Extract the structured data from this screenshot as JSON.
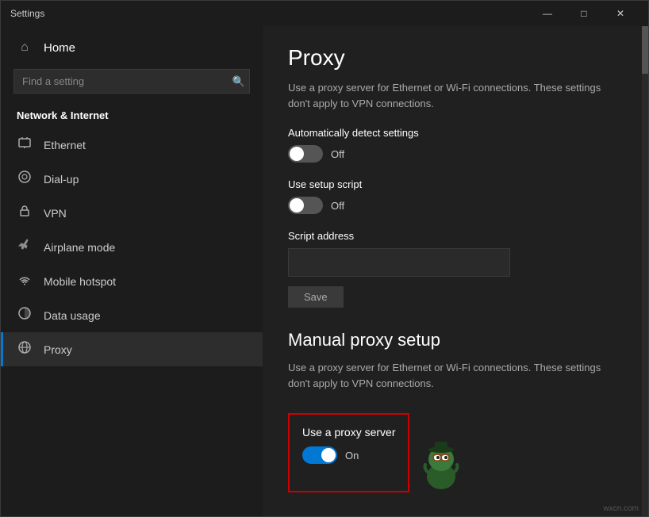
{
  "window": {
    "title": "Settings",
    "controls": {
      "minimize": "—",
      "maximize": "□",
      "close": "✕"
    }
  },
  "sidebar": {
    "home_label": "Home",
    "search_placeholder": "Find a setting",
    "section_title": "Network & Internet",
    "items": [
      {
        "id": "ethernet",
        "label": "Ethernet",
        "icon": "ethernet"
      },
      {
        "id": "dialup",
        "label": "Dial-up",
        "icon": "dialup"
      },
      {
        "id": "vpn",
        "label": "VPN",
        "icon": "vpn"
      },
      {
        "id": "airplane",
        "label": "Airplane mode",
        "icon": "airplane"
      },
      {
        "id": "hotspot",
        "label": "Mobile hotspot",
        "icon": "hotspot"
      },
      {
        "id": "data",
        "label": "Data usage",
        "icon": "data"
      },
      {
        "id": "proxy",
        "label": "Proxy",
        "icon": "proxy",
        "active": true
      }
    ]
  },
  "main": {
    "page_title": "Proxy",
    "auto_proxy_desc": "Use a proxy server for Ethernet or Wi-Fi connections. These settings don't apply to VPN connections.",
    "auto_detect": {
      "label": "Automatically detect settings",
      "state": "Off",
      "enabled": false
    },
    "setup_script": {
      "label": "Use setup script",
      "state": "Off",
      "enabled": false
    },
    "script_address": {
      "label": "Script address",
      "placeholder": ""
    },
    "save_button": "Save",
    "manual_section": {
      "title": "Manual proxy setup",
      "desc": "Use a proxy server for Ethernet or Wi-Fi connections. These settings don't apply to VPN connections.",
      "use_proxy": {
        "label": "Use a proxy server",
        "state": "On",
        "enabled": true
      }
    }
  },
  "watermark": "wxcn.com"
}
